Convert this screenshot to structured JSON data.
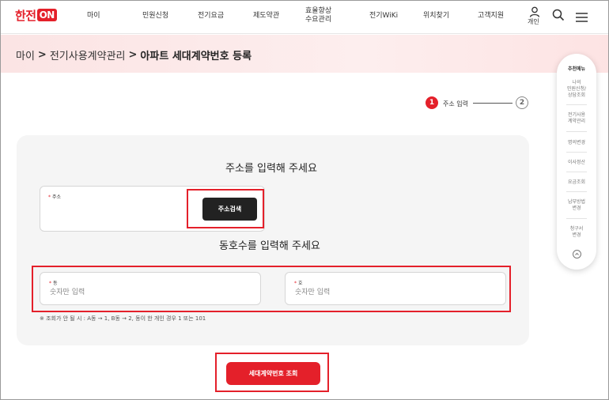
{
  "header": {
    "logo_text": "한전",
    "logo_on": "ON",
    "nav": [
      "마이",
      "민원신청",
      "전기요금",
      "제도약관",
      "효율향상\n수요관리",
      "전기WiKi",
      "위치찾기",
      "고객지원"
    ],
    "nav_efficiency_line1": "효율향상",
    "nav_efficiency_line2": "수요관리",
    "person_label": "개인",
    "icons": [
      "person-icon",
      "search-icon",
      "menu-icon"
    ]
  },
  "breadcrumb": {
    "items": [
      "마이",
      "전기사용계약관리",
      "아파트 세대계약번호 등록"
    ],
    "separator": ">"
  },
  "steps": {
    "step1_num": "1",
    "step1_label": "주소 입력",
    "step2_num": "2"
  },
  "form": {
    "address_title": "주소를 입력해 주세요",
    "address_label": "주소",
    "required_mark": "*",
    "search_button": "주소검색",
    "unit_title": "동호수를 입력해 주세요",
    "dong_label": "동",
    "dong_placeholder": "숫자만 입력",
    "ho_label": "호",
    "ho_placeholder": "숫자만 입력",
    "note": "※ 조회가 안 될 시 : A동 → 1, B동 → 2, 동이 한 개인 경우 1 또는 101"
  },
  "submit_button": "세대계약번호 조회",
  "side_menu": {
    "title": "추천메뉴",
    "items": [
      "나의\n민원신청/\n상담조회",
      "전기사용\n계약관리",
      "명의변경",
      "이사정산",
      "요금조회",
      "납부방법\n변경",
      "청구서\n변경"
    ]
  },
  "colors": {
    "accent": "#e4202a",
    "dark_button": "#222222",
    "panel": "#f5f5f5"
  }
}
